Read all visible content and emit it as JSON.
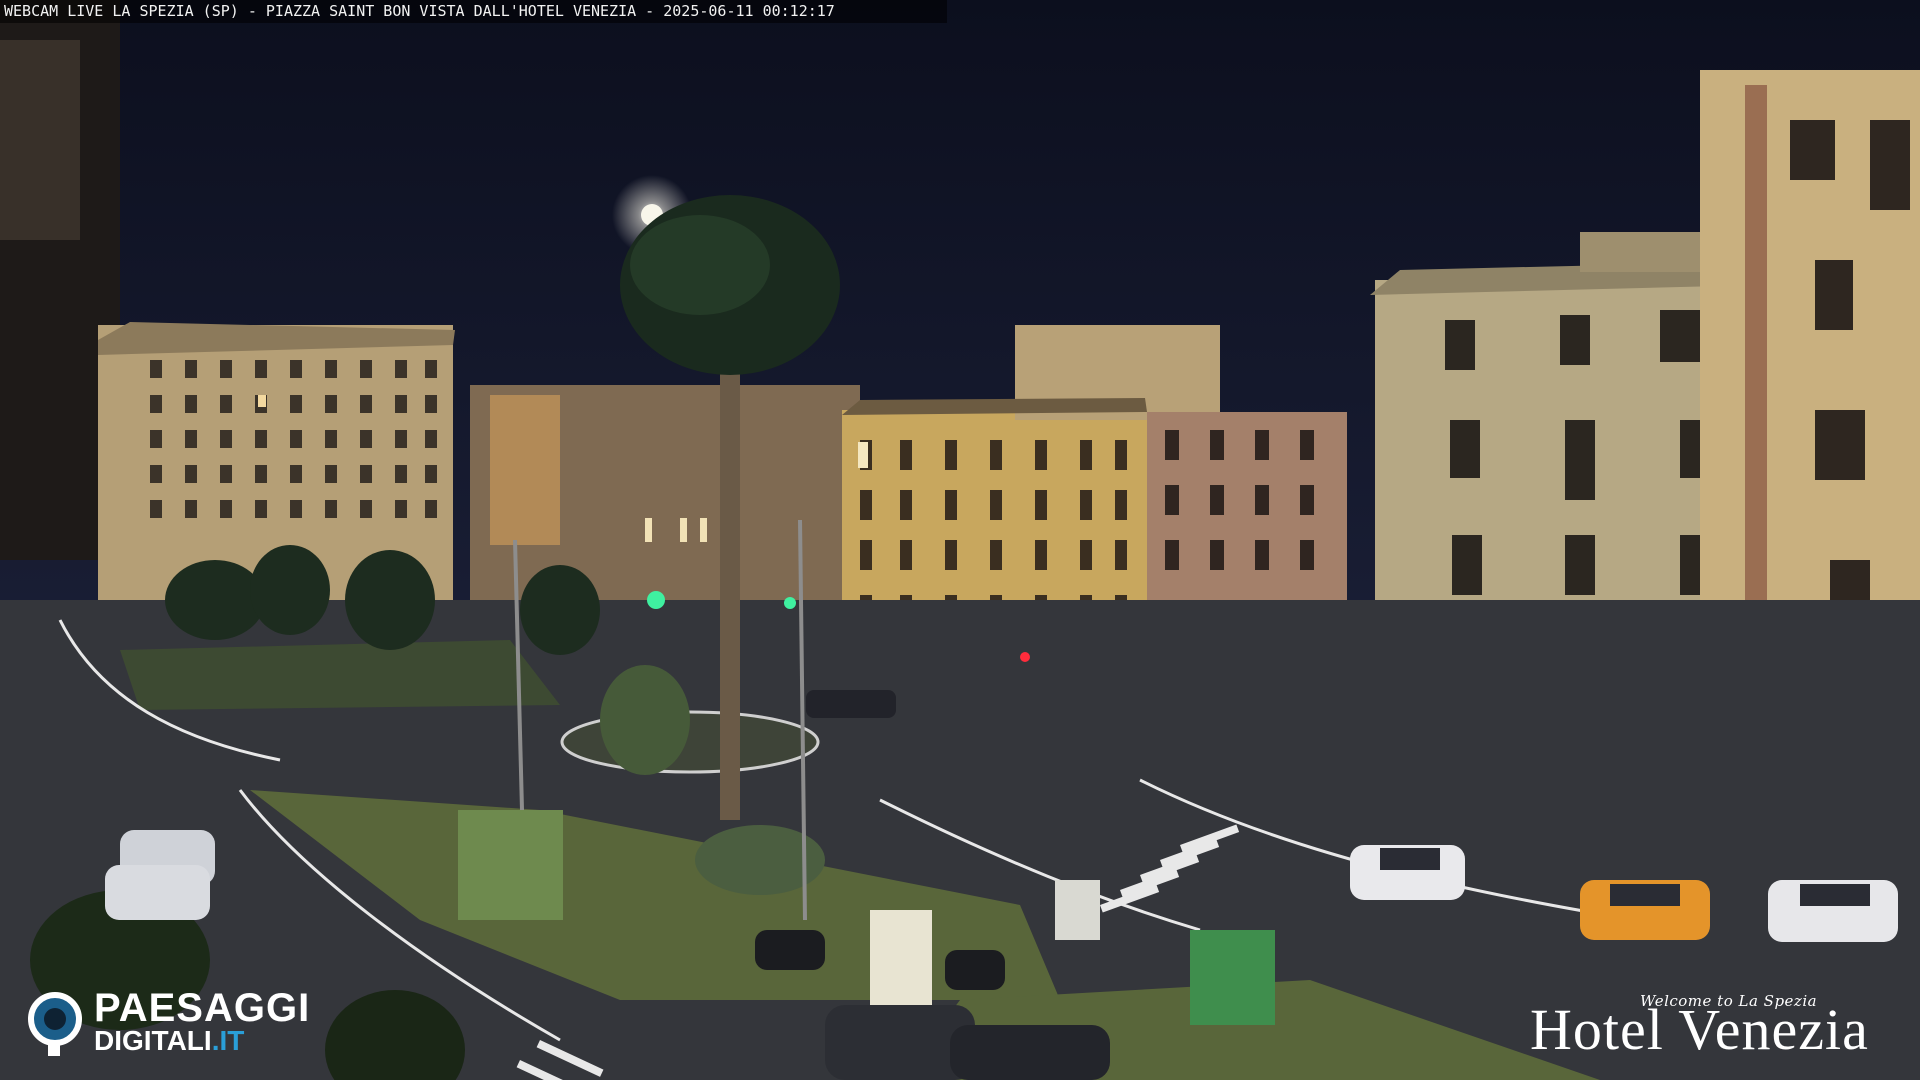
{
  "overlay": {
    "caption": "WEBCAM LIVE LA SPEZIA (SP) - PIAZZA SAINT BON VISTA DALL'HOTEL VENEZIA - 2025-06-11 00:12:17"
  },
  "logo_left": {
    "line1": "PAESAGGI",
    "line2_main": "DIGITALI",
    "line2_accent": ".IT"
  },
  "logo_right": {
    "tagline": "Welcome to La Spezia",
    "name": "Hotel Venezia"
  },
  "colors": {
    "sky": "#101629",
    "moon": "#f6f3e6",
    "building_yellow": "#d8b86e",
    "building_cream": "#d9cc9c",
    "road": "#3c3e44",
    "grass": "#5f6b3c",
    "traffic_light_green": "#3ff0a0",
    "traffic_light_red": "#ff2c3c",
    "car_orange": "#e4942a",
    "logo_accent": "#2a9fd8"
  }
}
